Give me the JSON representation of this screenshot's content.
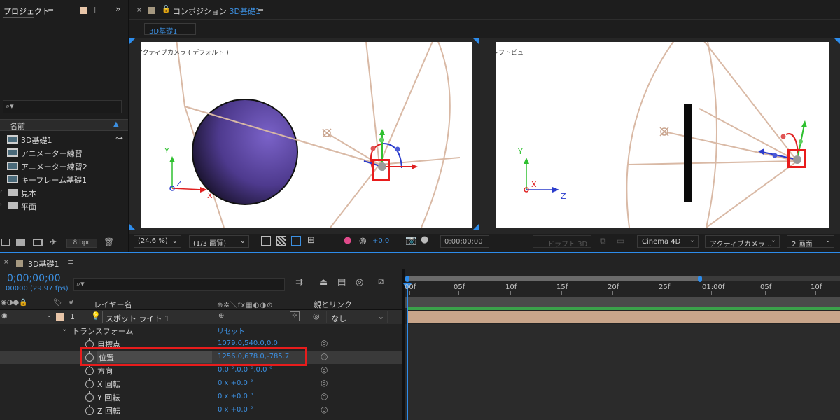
{
  "project_panel": {
    "tab_label": "プロジェクト",
    "search_placeholder": "",
    "column_name": "名前",
    "items": [
      {
        "name": "3D基礎1",
        "type": "comp"
      },
      {
        "name": "アニメーター練習",
        "type": "comp"
      },
      {
        "name": "アニメーター練習2",
        "type": "comp"
      },
      {
        "name": "キーフレーム基礎1",
        "type": "comp"
      },
      {
        "name": "見本",
        "type": "folder"
      },
      {
        "name": "平面",
        "type": "folder"
      }
    ],
    "bpc": "8 bpc"
  },
  "composition_panel": {
    "tab_prefix": "コンポジション",
    "tab_comp": "3D基礎1",
    "breadcrumb": "3D基礎1",
    "view_left_label": "アクティブカメラ ( デフォルト )",
    "view_right_label": "レフトビュー",
    "zoom": "(24.6 %)",
    "resolution": "(1/3 画質)",
    "exposure": "+0.0",
    "timecode": "0;00;00;00",
    "draft3d": "ドラフト 3D",
    "renderer": "Cinema 4D",
    "camera_view": "アクティブカメラ...",
    "view_layout": "2 画面"
  },
  "timeline_panel": {
    "tab_label": "3D基礎1",
    "timecode": "0;00;00;00",
    "frame_info": "00000 (29.97 fps)",
    "col_layer_name": "レイヤー名",
    "col_parent": "親とリンク",
    "layer": {
      "index": "1",
      "name": "スポット ライト 1",
      "parent": "なし"
    },
    "transform_label": "トランスフォーム",
    "reset_label": "リセット",
    "properties": [
      {
        "name": "目標点",
        "value": "1079.0,540.0,0.0"
      },
      {
        "name": "位置",
        "value": "1256.0,678.0,-785.7"
      },
      {
        "name": "方向",
        "value": "0.0 °,0.0 °,0.0 °"
      },
      {
        "name": "X 回転",
        "value": "0 x +0.0 °"
      },
      {
        "name": "Y 回転",
        "value": "0 x +0.0 °"
      },
      {
        "name": "Z 回転",
        "value": "0 x +0.0 °"
      }
    ],
    "ruler": [
      "00f",
      "05f",
      "10f",
      "15f",
      "20f",
      "25f",
      "01:00f",
      "05f",
      "10f"
    ]
  },
  "colors": {
    "accent_blue": "#2d8ceb",
    "highlight_red": "#e81c1c",
    "sphere": "#6a52b0",
    "layer_bar": "#c8a58a",
    "green_bar": "#3aa14a"
  }
}
